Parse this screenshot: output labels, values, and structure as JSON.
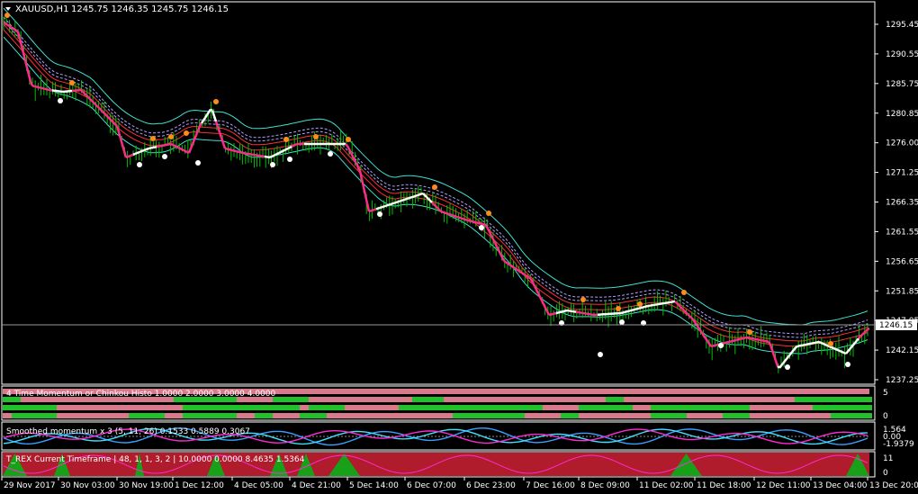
{
  "header": {
    "symbol": "XAUUSD,H1",
    "ohlc": "1245.75 1246.35 1245.75 1246.15",
    "menu_arrow_icon": "triangle-down-icon"
  },
  "colors": {
    "background": "#000000",
    "grid": "#ffffff",
    "candles": "#00c000",
    "band_outer": "#40e0d0",
    "band_mid": "#ff3030",
    "band_dashed": "#b0a0ff",
    "trend_down": "#ff2a8a",
    "trend_up": "#ffffff",
    "dot_orange": "#ff8c1a",
    "dot_white": "#ffffff",
    "hist_pink": "#d97a8c",
    "hist_green": "#22c02a",
    "trex_red": "#b01c2c",
    "trex_green": "#18a018",
    "momentum_blue": "#3aa0ff",
    "momentum_cyan": "#40e0ff",
    "momentum_magenta": "#ff2ad0"
  },
  "main_chart": {
    "current_price": "1246.15",
    "price_ticks": [
      "1295.45",
      "1290.55",
      "1285.75",
      "1280.85",
      "1276.00",
      "1271.25",
      "1266.35",
      "1261.55",
      "1256.65",
      "1251.85",
      "1247.05",
      "1242.15",
      "1237.25"
    ]
  },
  "indicators": {
    "time_momentum": {
      "title": "4 Time Momentum or Chinkou Histo 1.0000 2.0000 3.0000 4.0000",
      "scale_top": "5",
      "scale_bottom": "0"
    },
    "smoothed_momentum": {
      "title": "Smoothed momentum x 3 (5, 11, 26) 0.1533 0.5889 0.3067",
      "scale_top": "1.564",
      "scale_mid": "0.00",
      "scale_bottom": "-1.9379"
    },
    "trex": {
      "title": "T_REX Current Timeframe | 48, 1, 1, 3, 2 |  10.0000 0.0000 8.4635 1.5364",
      "scale_top": "11",
      "scale_bottom": "0"
    }
  },
  "time_axis": [
    "29 Nov 2017",
    "30 Nov 03:00",
    "30 Nov 19:00",
    "1 Dec 12:00",
    "4 Dec 05:00",
    "4 Dec 21:00",
    "5 Dec 14:00",
    "6 Dec 07:00",
    "6 Dec 23:00",
    "7 Dec 16:00",
    "8 Dec 09:00",
    "11 Dec 02:00",
    "11 Dec 18:00",
    "12 Dec 11:00",
    "13 Dec 04:00",
    "13 Dec 20:00"
  ]
}
